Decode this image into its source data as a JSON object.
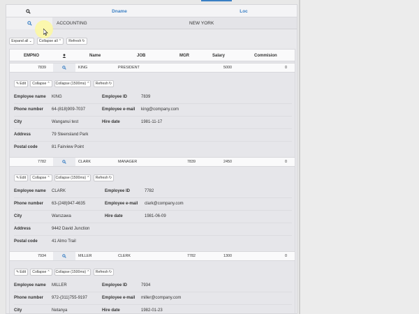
{
  "dept": {
    "header": {
      "dname": "Dname",
      "loc": "Loc"
    },
    "row": {
      "dname": "ACCOUNTING",
      "loc": "NEW YORK"
    }
  },
  "toolbar": {
    "expand_all": "Expand all",
    "collapse_all": "Collapse all",
    "refresh": "Refresh"
  },
  "emp_headers": {
    "empno": "EMPNO",
    "name": "Name",
    "job": "JOB",
    "mgr": "MGR",
    "salary": "Salary",
    "commision": "Commision"
  },
  "detail_labels": {
    "edit": "Edit",
    "collapse": "Collapse",
    "collapse_slow": "Collapse (1500ms)",
    "refresh": "Refresh",
    "employee_name": "Employee name",
    "employee_id": "Employee ID",
    "phone_number": "Phone number",
    "employee_email": "Employee e-mail",
    "city": "City",
    "hire_date": "Hire date",
    "address": "Address",
    "postal_code": "Postal code"
  },
  "employees": [
    {
      "empno": "7839",
      "name": "KING",
      "job": "PRESIDENT",
      "mgr": "",
      "salary": "5000",
      "commision": "0",
      "detail": {
        "name": "KING",
        "id": "7839",
        "phone": "64-(818)909-7037",
        "email": "king@company.com",
        "city": "Wanganui test",
        "hire_date": "1981-11-17",
        "address": "79 Steensland Park",
        "postal_code": "81 Fairview Point"
      }
    },
    {
      "empno": "7782",
      "name": "CLARK",
      "job": "MANAGER",
      "mgr": "7839",
      "salary": "2450",
      "commision": "0",
      "detail": {
        "name": "CLARK",
        "id": "7782",
        "phone": "63-(248)947-4635",
        "email": "clark@company.com",
        "city": "Warszawa",
        "hire_date": "1981-06-09",
        "address": "9442 David Junction",
        "postal_code": "41 Almo Trail"
      }
    },
    {
      "empno": "7934",
      "name": "MILLER",
      "job": "CLERK",
      "mgr": "7782",
      "salary": "1300",
      "commision": "0",
      "detail": {
        "name": "MILLER",
        "id": "7934",
        "phone": "972-(311)755-9197",
        "email": "miller@company.com",
        "city": "Netanya",
        "hire_date": "1982-01-23"
      }
    }
  ]
}
